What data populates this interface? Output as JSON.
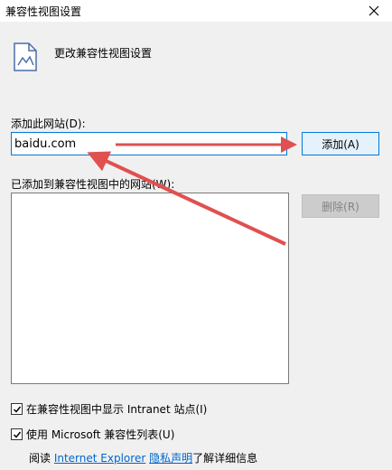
{
  "window": {
    "title": "兼容性视图设置",
    "close_icon": "close-icon"
  },
  "header": {
    "title": "更改兼容性视图设置",
    "icon": "page-icon"
  },
  "add_site": {
    "label": "添加此网站(D):",
    "value": "baidu.com",
    "add_button": "添加(A)"
  },
  "site_list": {
    "label": "已添加到兼容性视图中的网站(W):",
    "items": [],
    "remove_button": "删除(R)"
  },
  "options": {
    "intranet": {
      "label": "在兼容性视图中显示 Intranet 站点(I)",
      "checked": true
    },
    "ms_list": {
      "label": "使用 Microsoft 兼容性列表(U)",
      "checked": true
    }
  },
  "footer": {
    "prefix": "阅读 ",
    "link1": "Internet Explorer",
    "link2": "隐私声明",
    "suffix": "了解详细信息"
  },
  "colors": {
    "focus_border": "#0078d7",
    "link": "#0066cc",
    "annotation_arrow": "#e05050"
  }
}
